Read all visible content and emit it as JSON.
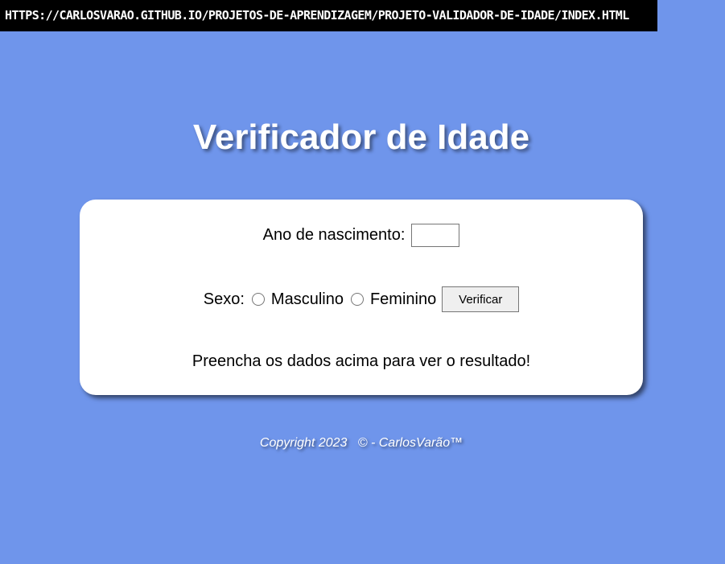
{
  "browser": {
    "url": "https://carlosvarao.github.io/projetos-de-aprendizagem/projeto-validador-de-idade/index.html"
  },
  "header": {
    "title": "Verificador de Idade"
  },
  "form": {
    "year_label": "Ano de nascimento:",
    "year_value": "",
    "sex_label": "Sexo:",
    "options": [
      {
        "label": "Masculino",
        "checked": false
      },
      {
        "label": "Feminino",
        "checked": false
      }
    ],
    "submit_label": "Verificar",
    "result_text": "Preencha os dados acima para ver o resultado!"
  },
  "footer": {
    "copyright": "Copyright 2023   © - CarlosVarão™"
  },
  "colors": {
    "background": "#6f95eb",
    "card": "#ffffff",
    "url_bar": "#000000"
  }
}
